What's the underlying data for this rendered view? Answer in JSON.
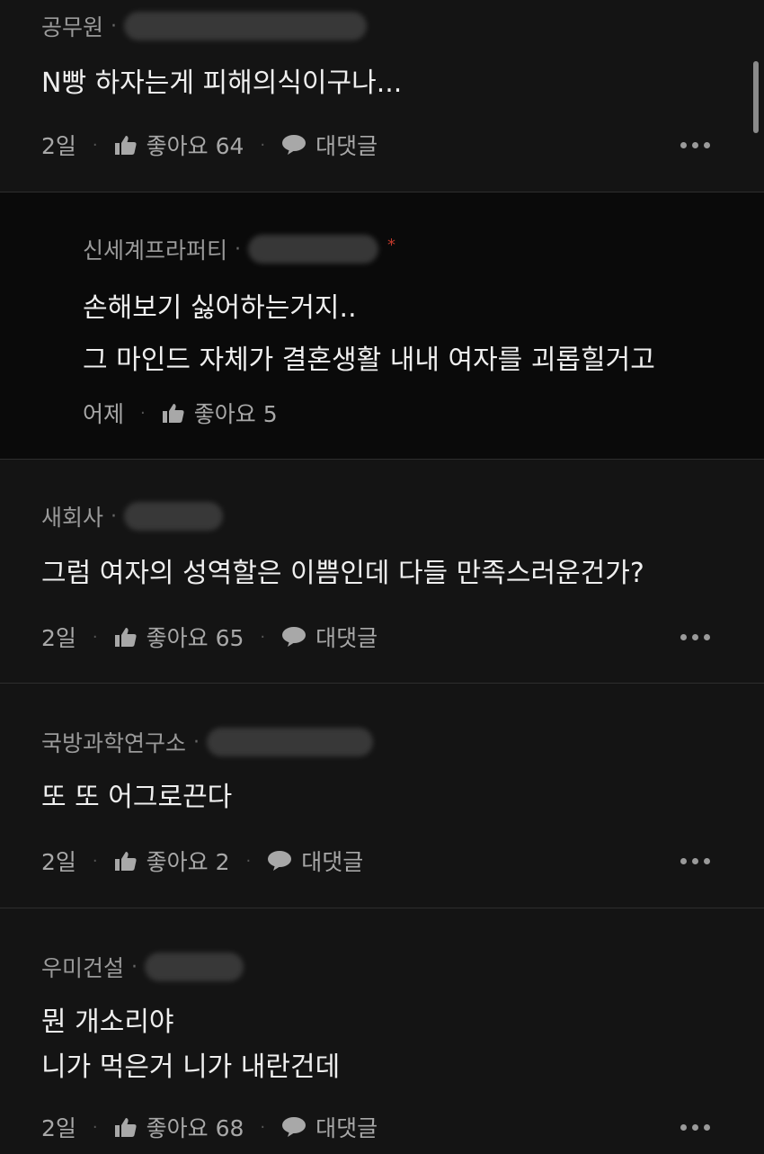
{
  "comments": [
    {
      "company": "공무원",
      "lines": [
        "N빵 하자는게 피해의식이구나..."
      ],
      "time": "2일",
      "likes": "좋아요 64",
      "reply_label": "대댓글"
    },
    {
      "company": "신세계프라퍼티",
      "lines": [
        "손해보기 싫어하는거지..",
        "그 마인드 자체가 결혼생활 내내 여자를 괴롭힐거고"
      ],
      "time": "어제",
      "likes": "좋아요 5",
      "marker": "*"
    },
    {
      "company": "새회사",
      "lines": [
        "그럼 여자의 성역할은 이쁨인데 다들 만족스러운건가?"
      ],
      "time": "2일",
      "likes": "좋아요 65",
      "reply_label": "대댓글"
    },
    {
      "company": "국방과학연구소",
      "lines": [
        "또 또 어그로끈다"
      ],
      "time": "2일",
      "likes": "좋아요 2",
      "reply_label": "대댓글"
    },
    {
      "company": "우미건설",
      "lines": [
        "뭔 개소리야",
        "니가 먹은거 니가 내란건데"
      ],
      "time": "2일",
      "likes": "좋아요 68",
      "reply_label": "대댓글"
    }
  ],
  "separator": "·",
  "icons": {
    "like": "thumbs-up-icon",
    "reply": "speech-bubble-icon",
    "more": "more-dots-icon"
  },
  "colors": {
    "background": "#141414",
    "reply_background": "#0a0a0a",
    "marker": "#c0392b"
  }
}
